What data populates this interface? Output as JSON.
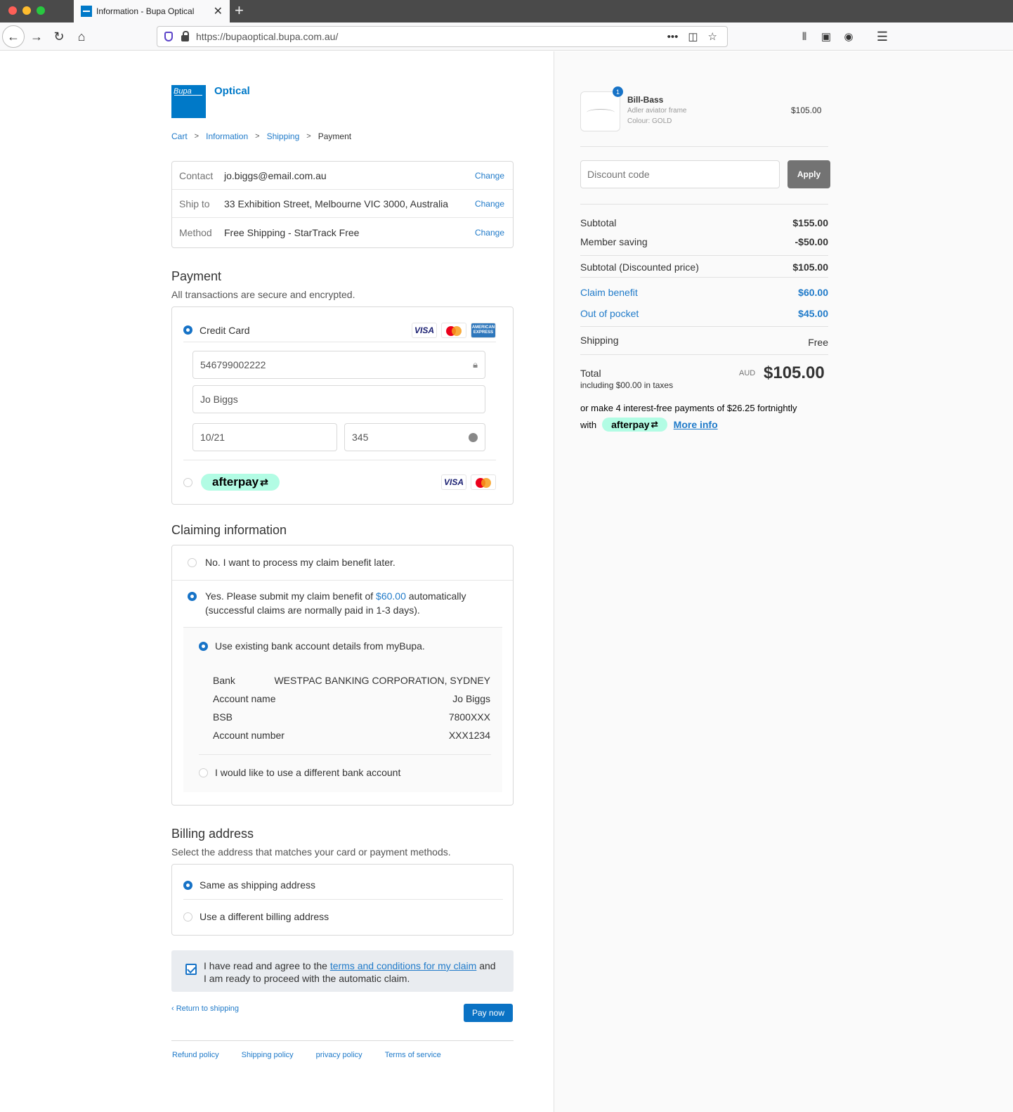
{
  "browser": {
    "tab_title": "Information - Bupa Optical",
    "tab_close": "✕",
    "new_tab": "+",
    "url": "https://bupaoptical.bupa.com.au/"
  },
  "logo": {
    "mark": "Bupa",
    "text": "Optical"
  },
  "breadcrumb": [
    "Cart",
    "Information",
    "Shipping",
    "Payment"
  ],
  "review": {
    "change_label": "Change",
    "rows": [
      {
        "label": "Contact",
        "value": "jo.biggs@email.com.au"
      },
      {
        "label": "Ship to",
        "value": "33 Exhibition Street, Melbourne VIC 3000, Australia"
      },
      {
        "label": "Method",
        "value": "Free Shipping - StarTrack Free"
      }
    ]
  },
  "payment": {
    "title": "Payment",
    "subtitle": "All transactions are secure and encrypted.",
    "credit_card_label": "Credit Card",
    "card_brands": [
      "VISA",
      "AMERICAN EXPRESS"
    ],
    "card_number": "546799002222",
    "name_on_card": "Jo Biggs",
    "expiry": "10/21",
    "cvv": "345",
    "afterpay_label": "afterpay",
    "afterpay_brand": "VISA"
  },
  "claiming": {
    "title": "Claiming information",
    "option_no": "No. I want to process my claim benefit later.",
    "option_yes_prefix": "Yes. Please submit my claim benefit of",
    "option_yes_amount": "$60.00",
    "option_yes_suffix": "automatically",
    "option_yes_line2": "(successful claims are normally paid in 1-3 days).",
    "use_existing": "Use existing bank account details from myBupa.",
    "bank": [
      {
        "label": "Bank",
        "value": "WESTPAC BANKING CORPORATION, SYDNEY"
      },
      {
        "label": "Account name",
        "value": "Jo Biggs"
      },
      {
        "label": "BSB",
        "value": "7800XXX"
      },
      {
        "label": "Account number",
        "value": "XXX1234"
      }
    ],
    "different_account": "I would like to use a different bank account"
  },
  "billing": {
    "title": "Billing address",
    "subtitle": "Select the address that matches your card or payment methods.",
    "same": "Same as shipping address",
    "different": "Use a different billing address"
  },
  "terms": {
    "prefix": "I have read and agree to the",
    "link": "terms and conditions for my claim",
    "suffix": "and",
    "line2": "I am ready to proceed with the automatic claim."
  },
  "actions": {
    "return": "‹ Return to shipping",
    "pay": "Pay now"
  },
  "footer": [
    "Refund policy",
    "Shipping policy",
    "privacy policy",
    "Terms of service"
  ],
  "order": {
    "quantity": "1",
    "product_name": "Bill-Bass",
    "product_desc": "Adler aviator frame",
    "product_colour": "Colour: GOLD",
    "product_price": "$105.00",
    "discount_placeholder": "Discount code",
    "apply": "Apply",
    "subtotal_label": "Subtotal",
    "subtotal": "$155.00",
    "saving_label": "Member saving",
    "saving": "-$50.00",
    "disc_label": "Subtotal (Discounted price)",
    "disc": "$105.00",
    "claim_label": "Claim benefit",
    "claim": "$60.00",
    "oop_label": "Out of pocket",
    "oop": "$45.00",
    "shipping_label": "Shipping",
    "shipping": "Free",
    "total_label": "Total",
    "taxes": "including $00.00 in taxes",
    "currency": "AUD",
    "total": "$105.00",
    "afterpay_line1": "or make 4 interest-free payments of $26.25 fortnightly",
    "afterpay_with": "with",
    "afterpay_label": "afterpay",
    "more_info": "More info"
  },
  "colors": {
    "brand_blue": "#0079c8",
    "link_blue": "#1f7ac9",
    "afterpay_mint": "#b2fce4"
  }
}
